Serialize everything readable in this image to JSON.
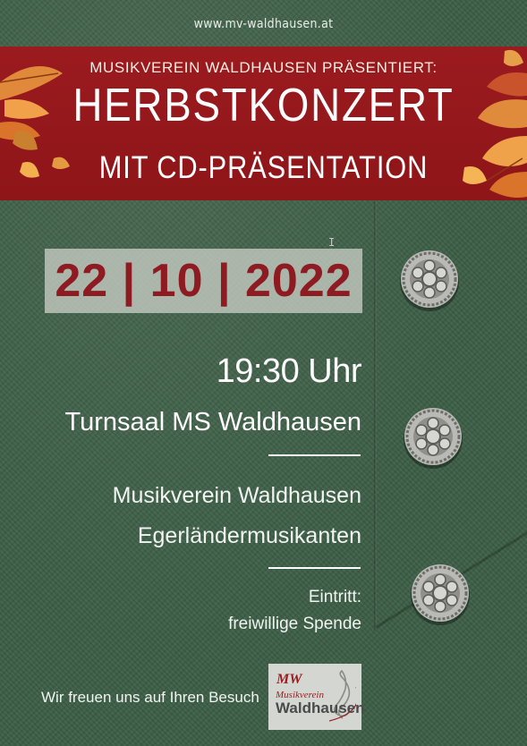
{
  "header": {
    "url": "www.mv-waldhausen.at"
  },
  "banner": {
    "presents": "MUSIKVEREIN WALDHAUSEN PRÄSENTIERT:",
    "title": "HERBSTKONZERT",
    "subtitle": "MIT CD-PRÄSENTATION",
    "color": "#9b1b1f"
  },
  "event": {
    "date": "22 | 10 | 2022",
    "time": "19:30 Uhr",
    "venue": "Turnsaal MS Waldhausen",
    "performers": [
      "Musikverein Waldhausen",
      "Egerländermusikanten"
    ],
    "entry_label": "Eintritt:",
    "entry_value": "freiwillige Spende",
    "date_color": "#8e1a22"
  },
  "footer": {
    "greeting": "Wir freuen uns auf Ihren Besuch",
    "logo": {
      "mark": "MW",
      "line1": "Musikverein",
      "line2": "Waldhausen"
    }
  },
  "background": {
    "color": "#3e6048"
  },
  "icons": [
    "autumn-leaf-icon",
    "trachten-button-icon",
    "text-cursor-icon",
    "treble-clef-icon"
  ]
}
